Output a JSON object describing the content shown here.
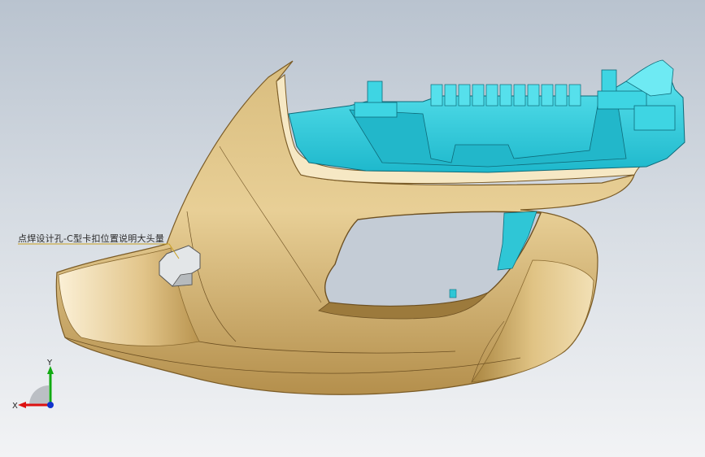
{
  "viewport": {
    "annotation_text": "点焊设计孔-C型卡扣位置说明大头量",
    "triad": {
      "x_label": "X",
      "y_label": "Y"
    }
  },
  "colors": {
    "shell": "#c8a865",
    "shell_dark": "#8c6a2e",
    "shell_light": "#f3e2b8",
    "bracket": "#2fd3e0",
    "bracket_dark": "#1a8ea0",
    "clip": "#d9dcdf",
    "axis_x": "#d11",
    "axis_y": "#1a1",
    "axis_z": "#13c"
  }
}
